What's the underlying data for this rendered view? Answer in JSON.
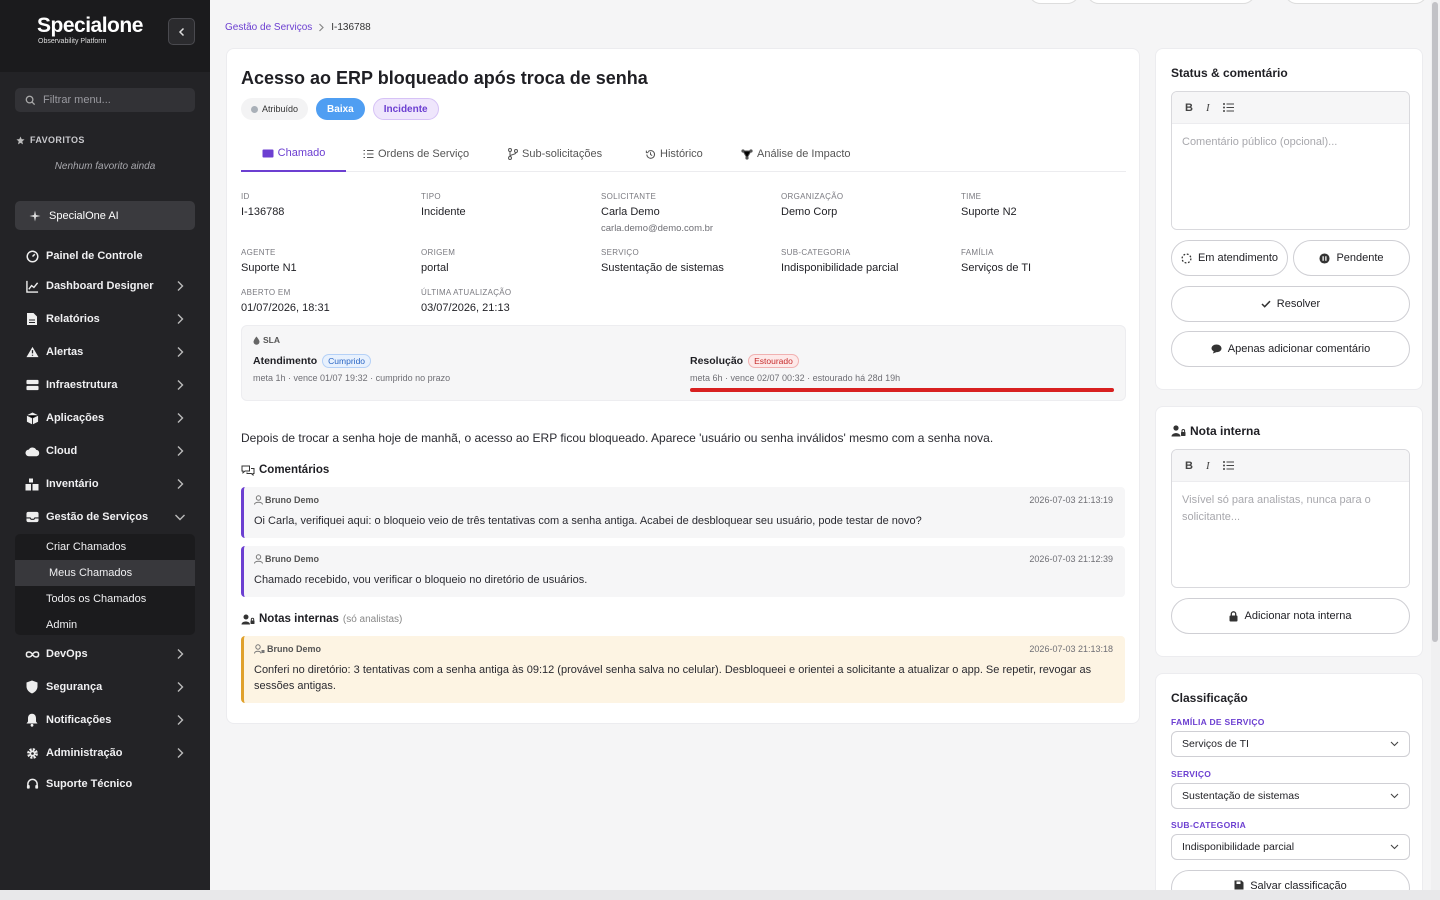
{
  "brand": {
    "name": "Specialone",
    "tagline": "Observability Platform"
  },
  "sidebar": {
    "filter_placeholder": "Filtrar menu...",
    "favorites_title": "FAVORITOS",
    "favorites_empty": "Nenhum favorito ainda",
    "ai_label": "SpecialOne AI",
    "items": [
      {
        "label": "Painel de Controle",
        "icon": "gauge-icon",
        "chevron": false
      },
      {
        "label": "Dashboard Designer",
        "icon": "chart-line-icon",
        "chevron": true
      },
      {
        "label": "Relatórios",
        "icon": "file-icon",
        "chevron": true
      },
      {
        "label": "Alertas",
        "icon": "warning-icon",
        "chevron": true
      },
      {
        "label": "Infraestrutura",
        "icon": "server-icon",
        "chevron": true
      },
      {
        "label": "Aplicações",
        "icon": "cube-icon",
        "chevron": true
      },
      {
        "label": "Cloud",
        "icon": "cloud-icon",
        "chevron": true
      },
      {
        "label": "Inventário",
        "icon": "boxes-icon",
        "chevron": true
      },
      {
        "label": "Gestão de Serviços",
        "icon": "inbox-icon",
        "chevron": true,
        "expanded": true
      },
      {
        "label": "DevOps",
        "icon": "infinity-icon",
        "chevron": true
      },
      {
        "label": "Segurança",
        "icon": "shield-icon",
        "chevron": true
      },
      {
        "label": "Notificações",
        "icon": "bell-icon",
        "chevron": true
      },
      {
        "label": "Administração",
        "icon": "gear-icon",
        "chevron": true
      },
      {
        "label": "Suporte Técnico",
        "icon": "headset-icon",
        "chevron": false
      }
    ],
    "submenu": [
      "Criar Chamados",
      "Meus Chamados",
      "Todos os Chamados",
      "Admin"
    ],
    "submenu_active": "Meus Chamados"
  },
  "breadcrumb": {
    "parent": "Gestão de Serviços",
    "current": "I-136788"
  },
  "ticket": {
    "title": "Acesso ao ERP bloqueado após troca de senha",
    "status": "Atribuído",
    "priority": "Baixa",
    "type": "Incidente",
    "tabs": [
      "Chamado",
      "Ordens de Serviço",
      "Sub-solicitações",
      "Histórico",
      "Análise de Impacto"
    ],
    "active_tab": "Chamado",
    "fields": {
      "id": {
        "label": "ID",
        "value": "I-136788"
      },
      "tipo": {
        "label": "TIPO",
        "value": "Incidente"
      },
      "solicitante": {
        "label": "SOLICITANTE",
        "value": "Carla Demo",
        "email": "carla.demo@demo.com.br"
      },
      "organizacao": {
        "label": "ORGANIZAÇÃO",
        "value": "Demo Corp"
      },
      "time": {
        "label": "TIME",
        "value": "Suporte N2"
      },
      "agente": {
        "label": "AGENTE",
        "value": "Suporte N1"
      },
      "origem": {
        "label": "ORIGEM",
        "value": "portal"
      },
      "servico": {
        "label": "SERVIÇO",
        "value": "Sustentação de sistemas"
      },
      "subcategoria": {
        "label": "SUB-CATEGORIA",
        "value": "Indisponibilidade parcial"
      },
      "familia": {
        "label": "FAMÍLIA",
        "value": "Serviços de TI"
      },
      "aberto": {
        "label": "ABERTO EM",
        "value": "01/07/2026, 18:31"
      },
      "atualizacao": {
        "label": "ÚLTIMA ATUALIZAÇÃO",
        "value": "03/07/2026, 21:13"
      }
    },
    "sla": {
      "title": "SLA",
      "atendimento": {
        "label": "Atendimento",
        "status": "Cumprido",
        "meta": "meta 1h · vence 01/07 19:32 · cumprido no prazo"
      },
      "resolucao": {
        "label": "Resolução",
        "status": "Estourado",
        "meta": "meta 6h · vence 02/07 00:32 · estourado há 28d 19h",
        "progress": 1.0
      }
    },
    "description": "Depois de trocar a senha hoje de manhã, o acesso ao ERP ficou bloqueado. Aparece 'usuário ou senha inválidos' mesmo com a senha nova.",
    "comments_title": "Comentários",
    "comments": [
      {
        "author": "Bruno Demo",
        "time": "2026-07-03 21:13:19",
        "text": "Oi Carla, verifiquei aqui: o bloqueio veio de três tentativas com a senha antiga. Acabei de desbloquear seu usuário, pode testar de novo?"
      },
      {
        "author": "Bruno Demo",
        "time": "2026-07-03 21:12:39",
        "text": "Chamado recebido, vou verificar o bloqueio no diretório de usuários."
      }
    ],
    "internal_title": "Notas internas",
    "internal_note_hint": "(só analistas)",
    "internal_notes": [
      {
        "author": "Bruno Demo",
        "time": "2026-07-03 21:13:18",
        "text": "Conferi no diretório: 3 tentativas com a senha antiga às 09:12 (provável senha salva no celular). Desbloqueei e orientei a solicitante a atualizar o app. Se repetir, revogar as sessões antigas."
      }
    ]
  },
  "status_panel": {
    "title": "Status & comentário",
    "placeholder": "Comentário público (opcional)...",
    "btn_em_atendimento": "Em atendimento",
    "btn_pendente": "Pendente",
    "btn_resolver": "Resolver",
    "btn_comentar": "Apenas adicionar comentário"
  },
  "note_panel": {
    "title": "Nota interna",
    "placeholder": "Visível só para analistas, nunca para o solicitante...",
    "btn_add": "Adicionar nota interna"
  },
  "class_panel": {
    "title": "Classificação",
    "familia_label": "FAMÍLIA DE SERVIÇO",
    "familia_value": "Serviços de TI",
    "servico_label": "SERVIÇO",
    "servico_value": "Sustentação de sistemas",
    "sub_label": "SUB-CATEGORIA",
    "sub_value": "Indisponibilidade parcial",
    "btn_save": "Salvar classificação"
  },
  "colors": {
    "accent": "#6c3fd1",
    "sidebar_bg": "#232326",
    "danger": "#d82020",
    "priority": "#4f9ef2"
  }
}
